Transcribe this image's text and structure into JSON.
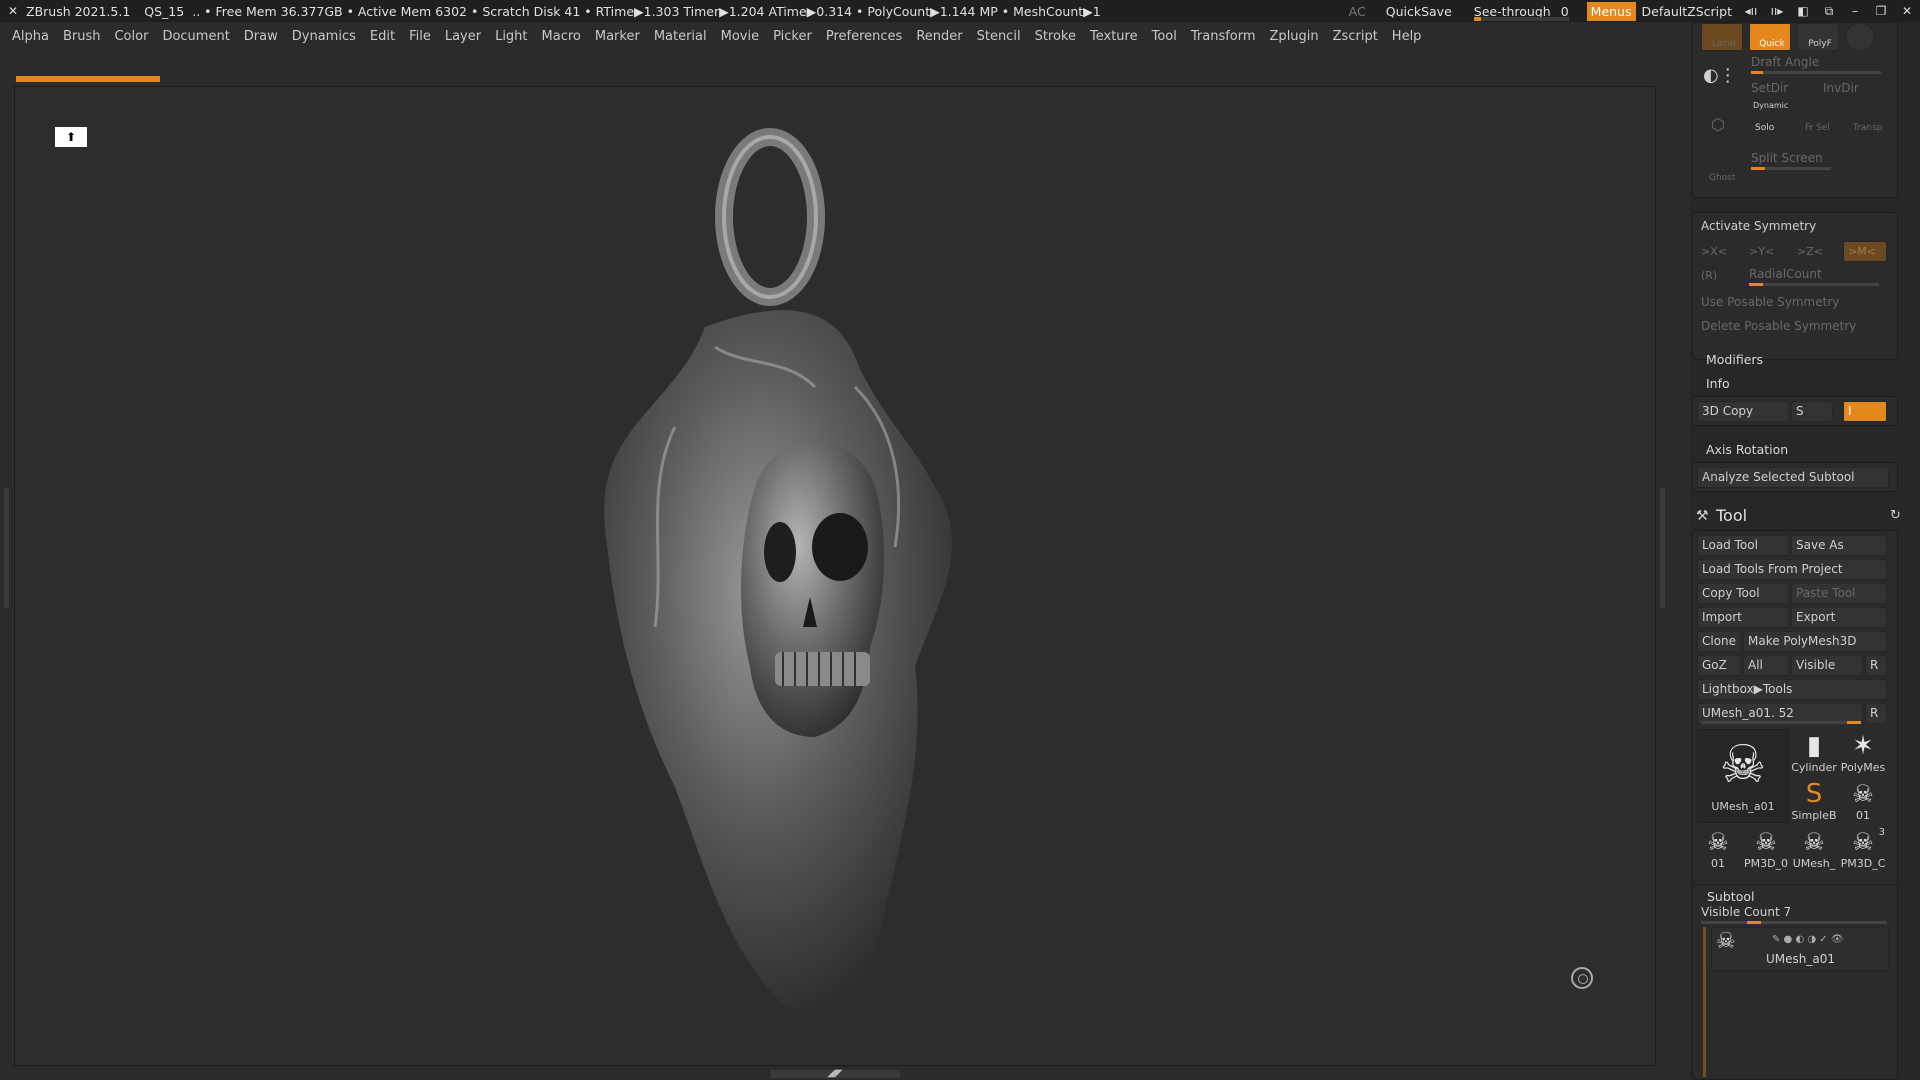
{
  "titlebar": {
    "app": "ZBrush 2021.5.1",
    "project": "QS_15",
    "stats": ".. • Free Mem 36.377GB • Active Mem 6302 • Scratch Disk 41 •  RTime▶1.303 Timer▶1.204 ATime▶0.314 • PolyCount▶1.144 MP  • MeshCount▶1",
    "ac": "AC",
    "quicksave": "QuickSave",
    "seethrough_label": "See-through",
    "seethrough_value": "0",
    "seethrough_level": 0.08,
    "menus": "Menus",
    "default_script": "DefaultZScript",
    "accent": "#e4881e"
  },
  "menubar": [
    "Alpha",
    "Brush",
    "Color",
    "Document",
    "Draw",
    "Dynamics",
    "Edit",
    "File",
    "Layer",
    "Light",
    "Macro",
    "Marker",
    "Material",
    "Movie",
    "Picker",
    "Preferences",
    "Render",
    "Stencil",
    "Stroke",
    "Texture",
    "Tool",
    "Transform",
    "Zplugin",
    "Zscript",
    "Help"
  ],
  "viewport": {
    "persp_icon": "figure-icon",
    "progress_fraction": 0.09
  },
  "tray_top": {
    "local": "Local",
    "quick": "Quick",
    "polyf": "PolyF",
    "draft_angle": "Draft Angle",
    "setdir": "SetDir",
    "invdir": "InvDir",
    "dynamic": "Dynamic",
    "solo": "Solo",
    "frsel": "Fr Sel",
    "transp": "Transp",
    "split_screen": "Split Screen",
    "ghost": "Ghost"
  },
  "symmetry": {
    "activate": "Activate Symmetry",
    "x": ">X<",
    "y": ">Y<",
    "z": ">Z<",
    "m": ">M<",
    "r": "(R)",
    "radial": "RadialCount",
    "use_posable": "Use Posable Symmetry",
    "delete_posable": "Delete Posable Symmetry"
  },
  "modifiers": "Modifiers",
  "info": "Info",
  "copy3d": {
    "label": "3D Copy",
    "s": "S",
    "value": "I"
  },
  "axis_rotation": "Axis Rotation",
  "analyze": "Analyze Selected Subtool",
  "tool": {
    "title": "Tool",
    "load_tool": "Load Tool",
    "save_as": "Save As",
    "load_from_project": "Load Tools From Project",
    "copy_tool": "Copy Tool",
    "paste_tool": "Paste Tool",
    "import": "Import",
    "export": "Export",
    "clone": "Clone",
    "make_polymesh": "Make PolyMesh3D",
    "goz": "GoZ",
    "all": "All",
    "visible": "Visible",
    "r": "R",
    "lightbox": "Lightbox▶Tools",
    "current": "UMesh_a01. 52",
    "current_r": "R",
    "thumbs": {
      "main": "UMesh_a01",
      "cylinder": "Cylinder",
      "polymesh": "PolyMes",
      "simpleb": "SimpleB",
      "n01": "01",
      "r1": "01",
      "r2": "PM3D_0",
      "r3": "UMesh_",
      "r4": "PM3D_C",
      "r4_badge": "3"
    }
  },
  "subtool": {
    "title": "Subtool",
    "visible_count": "Visible Count 7",
    "item": "UMesh_a01"
  }
}
